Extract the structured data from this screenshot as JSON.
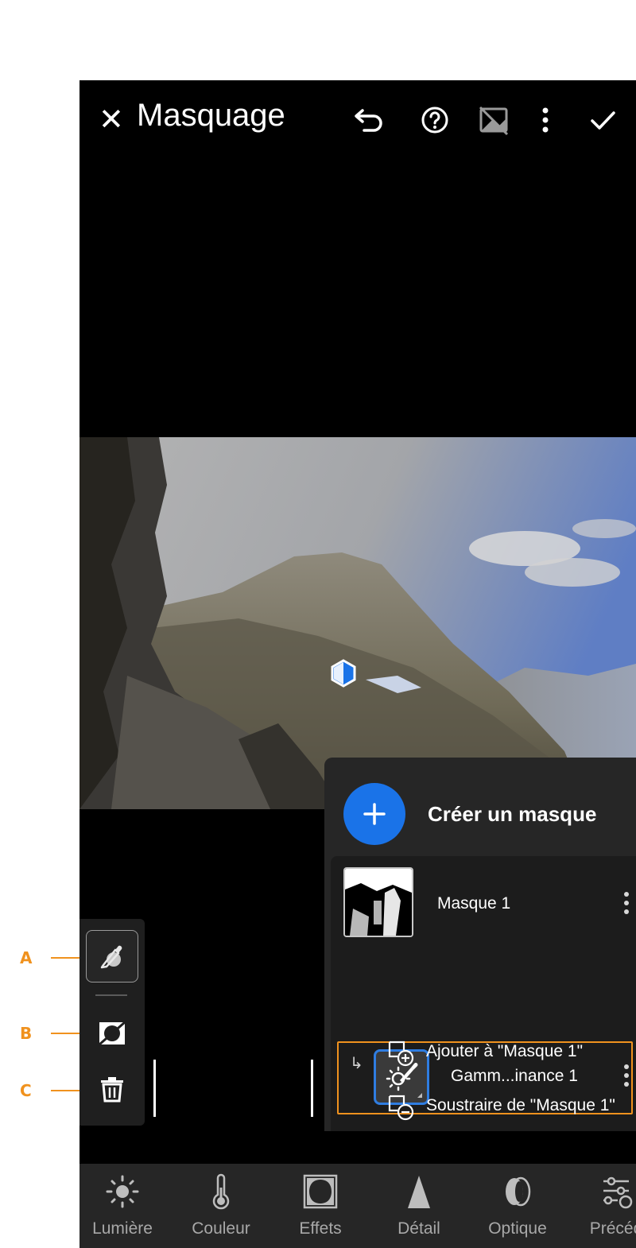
{
  "callouts": [
    {
      "letter": "A"
    },
    {
      "letter": "B"
    },
    {
      "letter": "C"
    }
  ],
  "header": {
    "close_glyph": "✕",
    "title": "Masquage",
    "icons": [
      "undo-icon",
      "help-icon",
      "mask-overlay-toggle-icon",
      "more-vertical-icon",
      "confirm-check-icon"
    ]
  },
  "mask_panel": {
    "create_label": "Créer un masque",
    "masks": [
      {
        "label": "Masque 1"
      }
    ],
    "sub_mask": {
      "label": "Gamm...inance 1"
    },
    "actions": [
      {
        "label": "Ajouter à \"Masque 1\"",
        "icon": "add-to-mask-icon"
      },
      {
        "label": "Soustraire de \"Masque 1\"",
        "icon": "subtract-from-mask-icon"
      }
    ]
  },
  "side_tools": [
    {
      "name": "color-picker-icon",
      "callout": "A"
    },
    {
      "name": "invert-mask-icon",
      "callout": "B"
    },
    {
      "name": "trash-icon",
      "callout": "C"
    }
  ],
  "bottom_tools": [
    {
      "label": "Lumière",
      "icon": "sun-icon"
    },
    {
      "label": "Couleur",
      "icon": "thermometer-icon"
    },
    {
      "label": "Effets",
      "icon": "vignette-icon"
    },
    {
      "label": "Détail",
      "icon": "triangle-icon"
    },
    {
      "label": "Optique",
      "icon": "lens-icon"
    },
    {
      "label": "Précéd",
      "icon": "presets-icon"
    }
  ],
  "colors": {
    "accent_blue": "#1a73e8",
    "highlight_orange": "#f0921e",
    "panel_bg": "#262626"
  }
}
